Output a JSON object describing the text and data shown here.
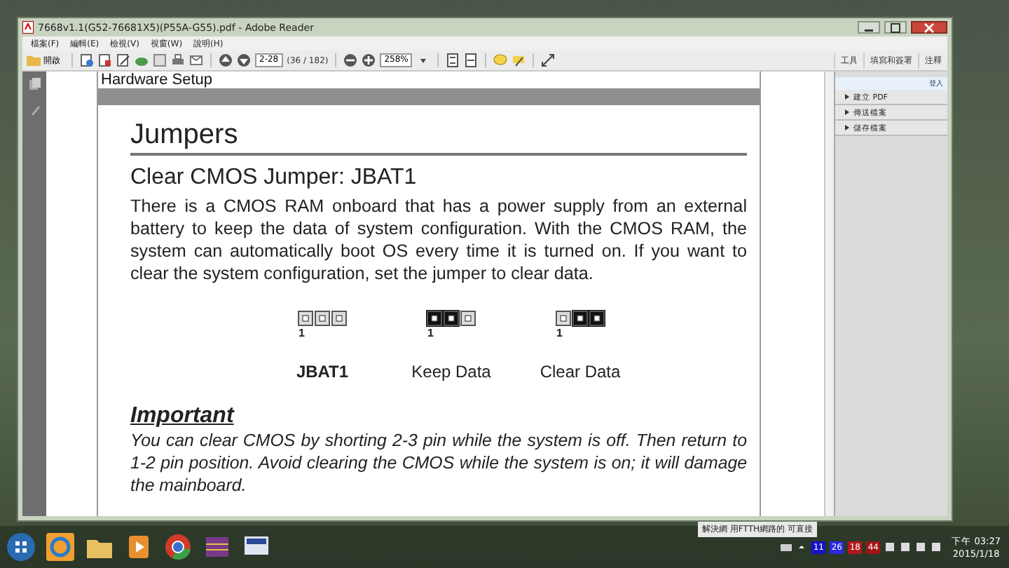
{
  "window": {
    "title": "7668v1.1(G52-76681X5)(P55A-G55).pdf - Adobe Reader"
  },
  "menu": [
    "檔案(F)",
    "編輯(E)",
    "檢視(V)",
    "視窗(W)",
    "說明(H)"
  ],
  "toolbar": {
    "open_label": "開啟",
    "page_field": "2-28",
    "page_count": "(36 / 182)",
    "zoom_field": "258%"
  },
  "tabs": [
    {
      "label": "工具",
      "selected": false
    },
    {
      "label": "填寫和簽署",
      "selected": false
    },
    {
      "label": "注釋",
      "selected": false
    }
  ],
  "tools_panel": {
    "sign_in": "登入",
    "items": [
      {
        "label": "建立 PDF",
        "expanded": false
      },
      {
        "label": "傳送檔案",
        "expanded": false
      },
      {
        "label": "儲存檔案",
        "expanded": false
      }
    ]
  },
  "document": {
    "header": "Hardware Setup",
    "title": "Jumpers",
    "subtitle": "Clear CMOS Jumper: JBAT1",
    "body": "There is a CMOS RAM onboard that has a power supply from an external battery to keep the data of system configuration. With the CMOS RAM, the system can automatically boot OS every time it is turned on. If you want to clear the system configuration, set the jumper to clear data.",
    "jumpers": [
      {
        "caption": "JBAT1",
        "pin_label": "1",
        "cap_on_pins_1_2": false,
        "cap_on_pins_2_3": false
      },
      {
        "caption": "Keep Data",
        "pin_label": "1",
        "cap_on_pins_1_2": true,
        "cap_on_pins_2_3": false
      },
      {
        "caption": "Clear Data",
        "pin_label": "1",
        "cap_on_pins_1_2": false,
        "cap_on_pins_2_3": true
      }
    ],
    "important_heading": "Important",
    "important_text": "You can clear CMOS by shorting 2-3 pin while the system is off. Then return to 1-2 pin position. Avoid clearing the CMOS while the system is on; it will damage the mainboard."
  },
  "tray": {
    "counters": [
      {
        "text": "11",
        "color": "#1414c8"
      },
      {
        "text": "26",
        "color": "#2a2ae0"
      },
      {
        "text": "18",
        "color": "#b01818"
      },
      {
        "text": "44",
        "color": "#a01414"
      }
    ],
    "notification": "解決網 用FTTH網路的 可直接",
    "time": "下午 03:27",
    "date": "2015/1/18"
  }
}
